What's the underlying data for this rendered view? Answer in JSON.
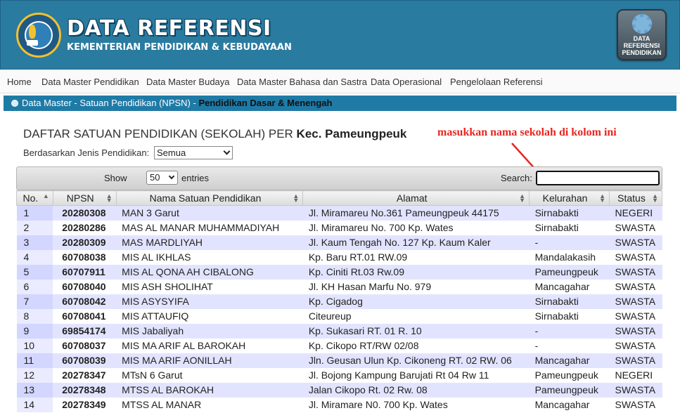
{
  "header": {
    "title": "DATA REFERENSI",
    "subtitle": "KEMENTERIAN PENDIDIKAN & KEBUDAYAAN",
    "badge_text": "DATA\nREFERENSI\nPENDIDIKAN"
  },
  "nav": {
    "items": [
      "Home",
      "Data Master Pendidikan",
      "Data Master Budaya",
      "Data Master Bahasa dan Sastra",
      "Data Operasional",
      "Pengelolaan Referensi"
    ]
  },
  "breadcrumb": {
    "path": "Data Master - Satuan Pendidikan (NPSN) - ",
    "current": "Pendidikan Dasar & Menengah"
  },
  "list": {
    "heading": "DAFTAR SATUAN PENDIDIKAN (SEKOLAH) PER ",
    "heading_place": "Kec. Pameungpeuk",
    "annotation": "masukkan nama sekolah di kolom ini",
    "filter_label": "Berdasarkan Jenis Pendidikan:",
    "filter_value": "Semua"
  },
  "toolbar": {
    "show_label": "Show",
    "entries_value": "50",
    "entries_label": "entries",
    "search_label": "Search:",
    "search_value": ""
  },
  "colors": {
    "header_bg": "#2a7ba0",
    "breadcrumb_bg": "#1f7aa6",
    "row_stripe": "#e2e4ff",
    "annotation": "#e8261f"
  },
  "table": {
    "columns": [
      "No.",
      "NPSN",
      "Nama Satuan Pendidikan",
      "Alamat",
      "Kelurahan",
      "Status"
    ],
    "rows": [
      [
        "1",
        "20280308",
        "MAN 3 Garut",
        "Jl. Miramareu No.361 Pameungpeuk 44175",
        "Sirnabakti",
        "NEGERI"
      ],
      [
        "2",
        "20280286",
        "MAS AL MANAR MUHAMMADIYAH",
        "Jl. Miramareu No. 700 Kp. Wates",
        "Sirnabakti",
        "SWASTA"
      ],
      [
        "3",
        "20280309",
        "MAS MARDLIYAH",
        "Jl. Kaum Tengah No. 127 Kp. Kaum Kaler",
        "-",
        "SWASTA"
      ],
      [
        "4",
        "60708038",
        "MIS AL IKHLAS",
        "Kp. Baru RT.01 RW.09",
        "Mandalakasih",
        "SWASTA"
      ],
      [
        "5",
        "60707911",
        "MIS AL QONA AH CIBALONG",
        "Kp. Ciniti Rt.03 Rw.09",
        "Pameungpeuk",
        "SWASTA"
      ],
      [
        "6",
        "60708040",
        "MIS ASH SHOLIHAT",
        "Jl. KH Hasan Marfu No. 979",
        "Mancagahar",
        "SWASTA"
      ],
      [
        "7",
        "60708042",
        "MIS ASYSYIFA",
        "Kp. Cigadog",
        "Sirnabakti",
        "SWASTA"
      ],
      [
        "8",
        "60708041",
        "MIS ATTAUFIQ",
        "Citeureup",
        "Sirnabakti",
        "SWASTA"
      ],
      [
        "9",
        "69854174",
        "MIS Jabaliyah",
        "Kp. Sukasari RT. 01 R. 10",
        "-",
        "SWASTA"
      ],
      [
        "10",
        "60708037",
        "MIS MA ARIF AL BAROKAH",
        "Kp. Cikopo RT/RW 02/08",
        "-",
        "SWASTA"
      ],
      [
        "11",
        "60708039",
        "MIS MA ARIF AONILLAH",
        "Jln. Geusan Ulun Kp. Cikoneng RT. 02 RW. 06",
        "Mancagahar",
        "SWASTA"
      ],
      [
        "12",
        "20278347",
        "MTsN 6 Garut",
        "Jl. Bojong Kampung Barujati Rt 04 Rw 11",
        "Pameungpeuk",
        "NEGERI"
      ],
      [
        "13",
        "20278348",
        "MTSS AL BAROKAH",
        "Jalan Cikopo Rt. 02 Rw. 08",
        "Pameungpeuk",
        "SWASTA"
      ],
      [
        "14",
        "20278349",
        "MTSS AL MANAR",
        "Jl. Miramare N0. 700 Kp. Wates",
        "Mancagahar",
        "SWASTA"
      ]
    ]
  }
}
